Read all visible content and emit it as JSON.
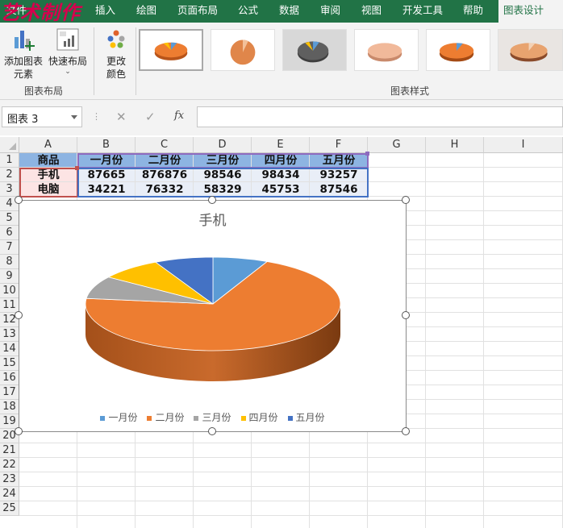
{
  "ribbon_tabs": [
    {
      "label": "文件"
    },
    {
      "label": "插入"
    },
    {
      "label": "绘图"
    },
    {
      "label": "页面布局"
    },
    {
      "label": "公式"
    },
    {
      "label": "数据"
    },
    {
      "label": "审阅"
    },
    {
      "label": "视图"
    },
    {
      "label": "开发工具"
    },
    {
      "label": "帮助"
    },
    {
      "label": "图表设计",
      "active": true
    }
  ],
  "watermark": "艺术制作",
  "ribbon": {
    "add_element_label": "添加图表\n元素",
    "quick_layout_label": "快速布局",
    "change_color_label": "更改\n颜色",
    "group_layout_label": "图表布局",
    "group_styles_label": "图表样式",
    "style_count": 6,
    "selected_style": 1
  },
  "formula_bar": {
    "name_box": "图表 3",
    "cancel_symbol": "✕",
    "enter_symbol": "✓",
    "fx_label": "fx",
    "formula": ""
  },
  "sheet": {
    "columns": [
      "A",
      "B",
      "C",
      "D",
      "E",
      "F",
      "G",
      "H",
      "I"
    ],
    "rows": [
      "1",
      "2",
      "3",
      "4",
      "5",
      "6",
      "7",
      "8",
      "9",
      "10",
      "11",
      "12",
      "13",
      "14",
      "15",
      "16",
      "17",
      "18",
      "19",
      "20",
      "21",
      "22",
      "23",
      "24",
      "25"
    ],
    "header_row": [
      "商品",
      "一月份",
      "二月份",
      "三月份",
      "四月份",
      "五月份"
    ],
    "data_rows": [
      [
        "手机",
        "87665",
        "876876",
        "98546",
        "98434",
        "93257"
      ],
      [
        "电脑",
        "34221",
        "76332",
        "58329",
        "45753",
        "87546"
      ]
    ],
    "colors": {
      "header_fill": "#8db4e2",
      "label_fill": "#fce4e4",
      "value_fill": "#e9eef7"
    }
  },
  "chart_data": {
    "type": "pie",
    "title": "手机",
    "categories": [
      "一月份",
      "二月份",
      "三月份",
      "四月份",
      "五月份"
    ],
    "values": [
      87665,
      876876,
      98546,
      98434,
      93257
    ],
    "colors": [
      "#5b9bd5",
      "#ed7d31",
      "#a5a5a5",
      "#ffc000",
      "#4472c4"
    ],
    "legend_position": "bottom",
    "three_d": true
  }
}
